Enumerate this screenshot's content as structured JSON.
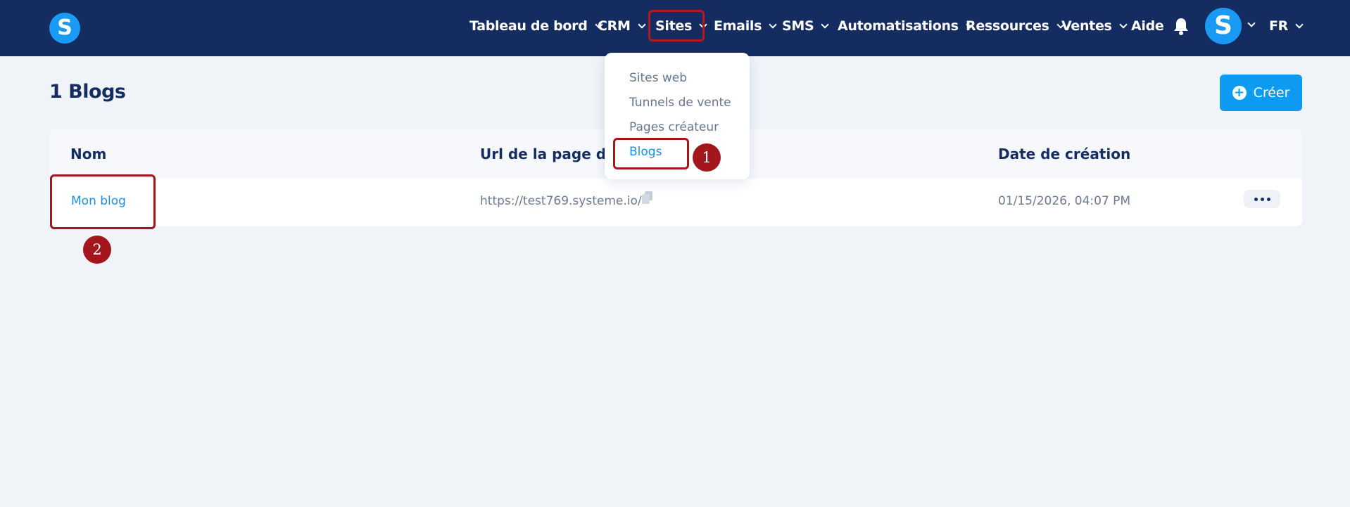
{
  "nav": {
    "logo_letter": "S",
    "items": [
      {
        "label": "Tableau de bord",
        "has_chevron": true
      },
      {
        "label": "CRM",
        "has_chevron": true
      },
      {
        "label": "Sites",
        "has_chevron": true
      },
      {
        "label": "Emails",
        "has_chevron": true
      },
      {
        "label": "SMS",
        "has_chevron": true
      },
      {
        "label": "Automatisations",
        "has_chevron": true
      },
      {
        "label": "Ressources",
        "has_chevron": true
      },
      {
        "label": "Ventes",
        "has_chevron": true
      },
      {
        "label": "Aide",
        "has_chevron": false
      }
    ],
    "avatar_letter": "S",
    "language": "FR"
  },
  "sites_menu": {
    "items": [
      {
        "label": "Sites web",
        "active": false
      },
      {
        "label": "Tunnels de vente",
        "active": false
      },
      {
        "label": "Pages créateur",
        "active": false
      },
      {
        "label": "Blogs",
        "active": true
      }
    ]
  },
  "page": {
    "title": "1 Blogs",
    "create_label": "Créer"
  },
  "table": {
    "headers": [
      "Nom",
      "Url de la page d'a",
      "Date de création"
    ],
    "rows": [
      {
        "name": "Mon blog",
        "url": "https://test769.systeme.io/",
        "created": "01/15/2026, 04:07 PM"
      }
    ]
  },
  "annotations": {
    "step1": "1",
    "step2": "2"
  },
  "colors": {
    "navbar": "#142c5f",
    "accent": "#0c9bf1",
    "highlight": "#a3161c"
  }
}
